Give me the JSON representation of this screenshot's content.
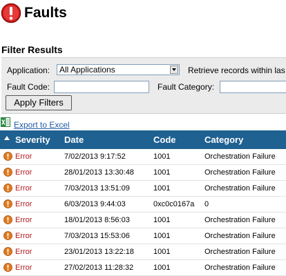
{
  "header": {
    "title": "Faults",
    "icon": "fault-error-icon"
  },
  "filter": {
    "section_title": "Filter Results",
    "application_label": "Application:",
    "application_value": "All Applications",
    "retrieve_label": "Retrieve records within las",
    "fault_code_label": "Fault Code:",
    "fault_code_value": "",
    "fault_category_label": "Fault Category:",
    "fault_category_value": "",
    "apply_button": "Apply Filters"
  },
  "export": {
    "label": "Export to Excel",
    "icon": "excel-icon"
  },
  "grid": {
    "header_color": "#1f6191",
    "columns": [
      "Severity",
      "Date",
      "Code",
      "Category"
    ],
    "rows": [
      {
        "severity": "Error",
        "date": "7/02/2013 9:17:52",
        "code": "1001",
        "category": "Orchestration Failure"
      },
      {
        "severity": "Error",
        "date": "28/01/2013 13:30:48",
        "code": "1001",
        "category": "Orchestration Failure"
      },
      {
        "severity": "Error",
        "date": "7/03/2013 13:51:09",
        "code": "1001",
        "category": "Orchestration Failure"
      },
      {
        "severity": "Error",
        "date": "6/03/2013 9:44:03",
        "code": "0xc0c0167a",
        "category": "0"
      },
      {
        "severity": "Error",
        "date": "18/01/2013 8:56:03",
        "code": "1001",
        "category": "Orchestration Failure"
      },
      {
        "severity": "Error",
        "date": "7/03/2013 15:53:06",
        "code": "1001",
        "category": "Orchestration Failure"
      },
      {
        "severity": "Error",
        "date": "23/01/2013 13:22:18",
        "code": "1001",
        "category": "Orchestration Failure"
      },
      {
        "severity": "Error",
        "date": "27/02/2013 11:28:32",
        "code": "1001",
        "category": "Orchestration Failure"
      }
    ]
  }
}
